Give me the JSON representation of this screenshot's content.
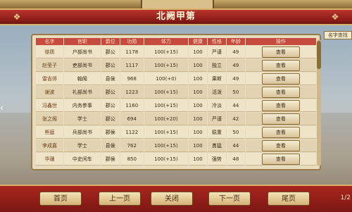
{
  "window": {
    "title": "北阙甲第"
  },
  "search_tag": "名字查找",
  "table": {
    "headers": [
      "名字",
      "官职",
      "爵位",
      "功勋",
      "体力",
      "健康",
      "性格",
      "年龄",
      "操作"
    ],
    "rows": [
      [
        "徐质",
        "户部尚书",
        "郡公",
        "1178",
        "100(+15)",
        "100",
        "严谨",
        "49",
        "查看"
      ],
      [
        "赵莹子",
        "吏部尚书",
        "郡公",
        "1117",
        "100(+15)",
        "100",
        "独立",
        "49",
        "查看"
      ],
      [
        "雷吉师",
        "翰阁",
        "县侯",
        "968",
        "100(+0)",
        "100",
        "果断",
        "49",
        "查看"
      ],
      [
        "谢波",
        "礼部尚书",
        "郡公",
        "1223",
        "100(+15)",
        "100",
        "活泼",
        "50",
        "查看"
      ],
      [
        "冯鑫世",
        "内务参事",
        "郡公",
        "1160",
        "100(+15)",
        "100",
        "冷淡",
        "44",
        "查看"
      ],
      [
        "张之阁",
        "学士",
        "郡公",
        "694",
        "100(+20)",
        "100",
        "严谨",
        "42",
        "查看"
      ],
      [
        "熊庭",
        "兵部尚书",
        "郡侯",
        "1122",
        "100(+15)",
        "100",
        "稳重",
        "50",
        "查看"
      ],
      [
        "李成嘉",
        "学士",
        "县侯",
        "762",
        "100(+15)",
        "100",
        "勇猛",
        "44",
        "查看"
      ],
      [
        "华珊",
        "中史闲车",
        "郡侯",
        "850",
        "100(+15)",
        "100",
        "强势",
        "48",
        "查看"
      ]
    ]
  },
  "nav": {
    "first": "首页",
    "prev": "上一页",
    "close": "关闭",
    "next": "下一页",
    "last": "尾页",
    "page": "1/2"
  },
  "colors": {
    "title_red": "#8d1c18",
    "header_red": "#c74a3e",
    "gold": "#d9b36a",
    "panel": "#e8dcbe"
  }
}
